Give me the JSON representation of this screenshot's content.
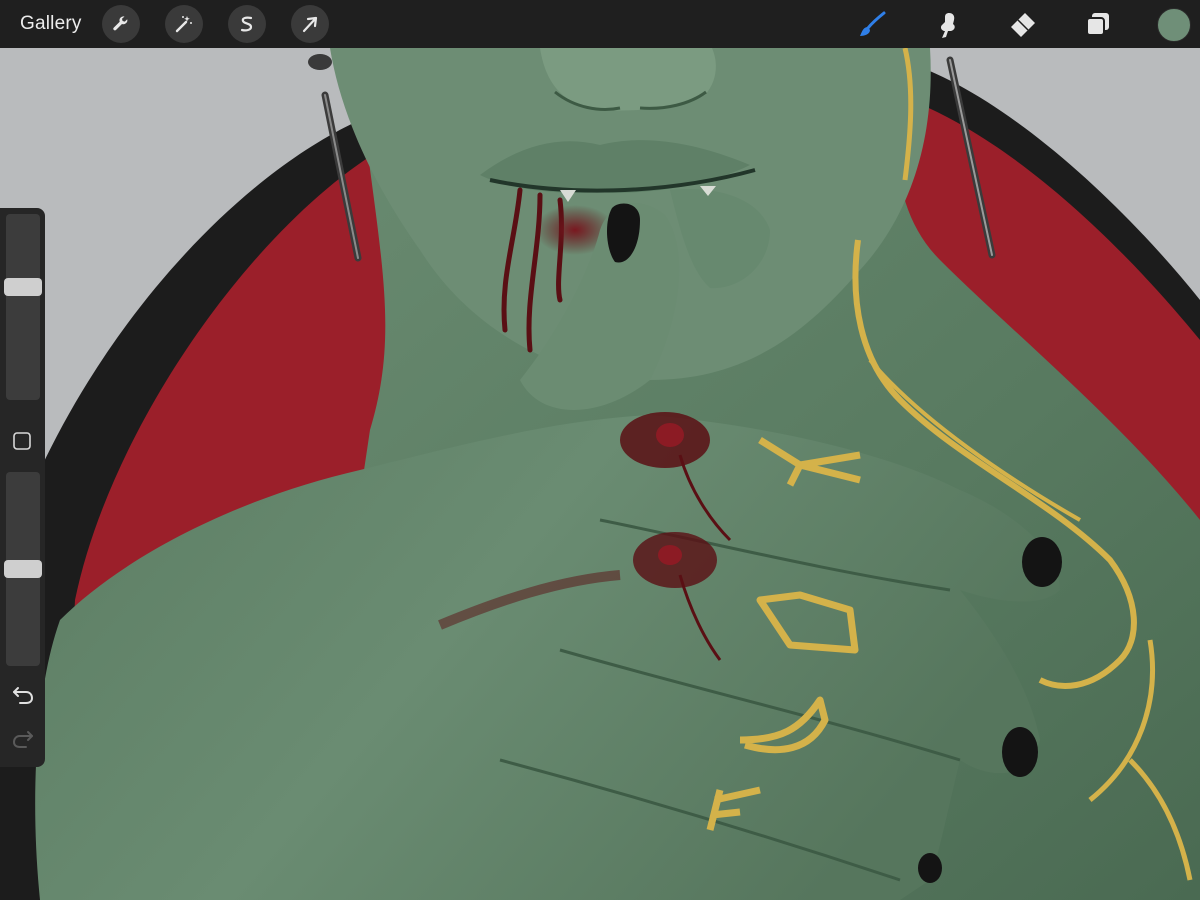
{
  "toolbar": {
    "gallery_label": "Gallery",
    "left_tools": [
      {
        "name": "actions",
        "icon": "wrench-icon"
      },
      {
        "name": "adjustments",
        "icon": "magic-wand-icon"
      },
      {
        "name": "selection",
        "icon": "selection-s-icon"
      },
      {
        "name": "transform",
        "icon": "arrow-cursor-icon"
      }
    ],
    "right_tools": [
      {
        "name": "brush",
        "icon": "brush-icon",
        "active": true
      },
      {
        "name": "smudge",
        "icon": "smudge-finger-icon",
        "active": false
      },
      {
        "name": "eraser",
        "icon": "eraser-icon",
        "active": false
      },
      {
        "name": "layers",
        "icon": "layers-icon",
        "active": false
      }
    ],
    "current_color": "#6f8f78",
    "active_tool_color": "#2f7fe8"
  },
  "sidebar": {
    "brush_size_level": 0.62,
    "brush_opacity_level": 0.5,
    "modify_button_icon": "square-icon",
    "undo_icon": "undo-arrow-icon",
    "redo_icon": "redo-arrow-icon",
    "redo_enabled": false
  },
  "artwork": {
    "background_color": "#b9bbbd",
    "backdrop_color": "#1c1c1c",
    "red_shape_color": "#9b1f2a",
    "skin_color": "#5f7f66",
    "gold_color": "#d4b24a",
    "blood_color": "#5a0f14",
    "nail_color": "#141414"
  }
}
